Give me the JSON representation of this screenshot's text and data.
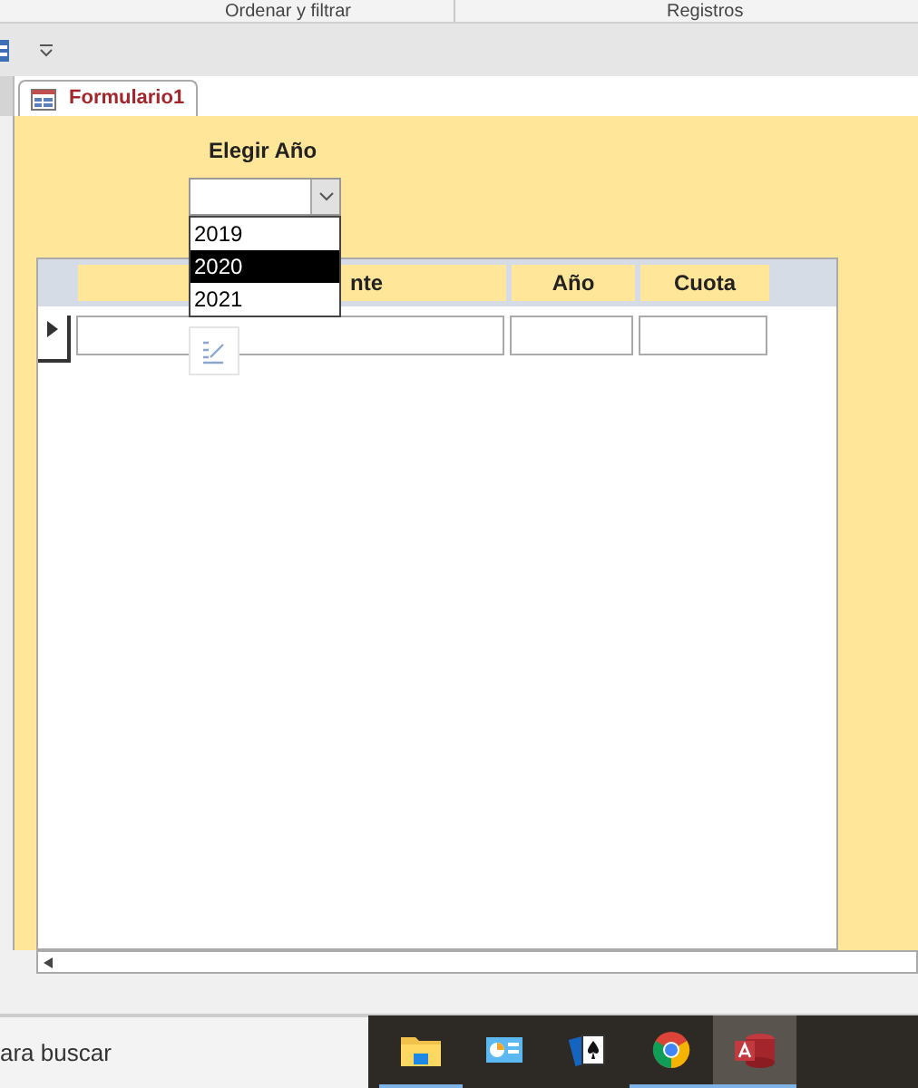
{
  "ribbon_groups": [
    "Ordenar y filtrar",
    "Registros"
  ],
  "tabs": [
    {
      "label": "Formulario1",
      "selected": true
    }
  ],
  "form": {
    "label": "Elegir Año",
    "combo": {
      "expanded": true,
      "options": [
        {
          "label": "2019",
          "selected": false
        },
        {
          "label": "2020",
          "selected": true
        },
        {
          "label": "2021",
          "selected": false
        }
      ]
    },
    "subform": {
      "columns": [
        "nte",
        "Año",
        "Cuota"
      ]
    }
  },
  "taskbar": {
    "search": {
      "placeholder": "ara buscar"
    },
    "apps": [
      {
        "kind": "folder",
        "running": true,
        "active": false
      },
      {
        "kind": "panel",
        "running": false,
        "active": false
      },
      {
        "kind": "cards",
        "running": false,
        "active": false
      },
      {
        "kind": "chrome",
        "running": true,
        "active": false
      },
      {
        "kind": "access",
        "running": true,
        "active": true
      }
    ]
  }
}
